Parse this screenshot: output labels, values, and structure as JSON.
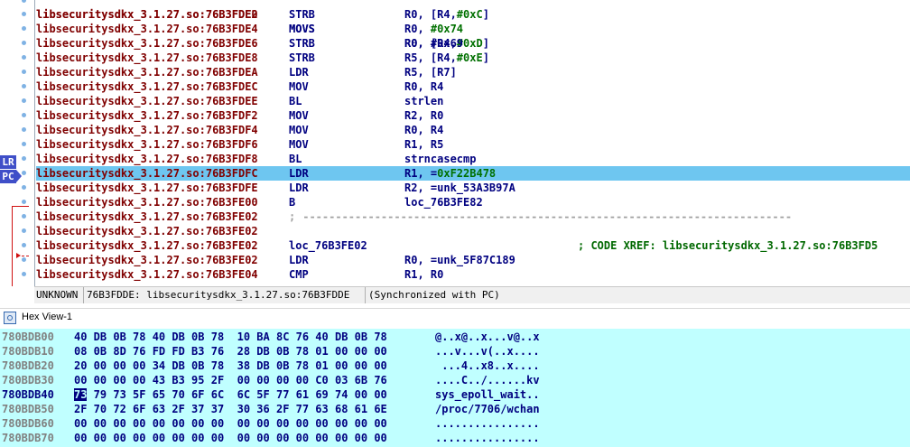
{
  "disasm": {
    "partial_top_row": {
      "addr": "libsecuritysdkx_3.1.27.so:76B3FDE0",
      "mnemonic": "MOVS",
      "operands": "R0, #0x69"
    },
    "rows": [
      {
        "addr": "libsecuritysdkx_3.1.27.so:76B3FDE2",
        "mnemonic": "STRB",
        "operands": "R0, [R4,#0xC]"
      },
      {
        "addr": "libsecuritysdkx_3.1.27.so:76B3FDE4",
        "mnemonic": "MOVS",
        "operands": "R0, #0x74"
      },
      {
        "addr": "libsecuritysdkx_3.1.27.so:76B3FDE6",
        "mnemonic": "STRB",
        "operands": "R0, [R4,#0xD]"
      },
      {
        "addr": "libsecuritysdkx_3.1.27.so:76B3FDE8",
        "mnemonic": "STRB",
        "operands": "R5, [R4,#0xE]"
      },
      {
        "addr": "libsecuritysdkx_3.1.27.so:76B3FDEA",
        "mnemonic": "LDR",
        "operands": "R5, [R7]"
      },
      {
        "addr": "libsecuritysdkx_3.1.27.so:76B3FDEC",
        "mnemonic": "MOV",
        "operands": "R0, R4"
      },
      {
        "addr": "libsecuritysdkx_3.1.27.so:76B3FDEE",
        "mnemonic": "BL",
        "operands": "strlen"
      },
      {
        "addr": "libsecuritysdkx_3.1.27.so:76B3FDF2",
        "mnemonic": "MOV",
        "operands": "R2, R0"
      },
      {
        "addr": "libsecuritysdkx_3.1.27.so:76B3FDF4",
        "mnemonic": "MOV",
        "operands": "R0, R4"
      },
      {
        "addr": "libsecuritysdkx_3.1.27.so:76B3FDF6",
        "mnemonic": "MOV",
        "operands": "R1, R5"
      },
      {
        "addr": "libsecuritysdkx_3.1.27.so:76B3FDF8",
        "mnemonic": "BL",
        "operands": "strncasecmp"
      },
      {
        "addr": "libsecuritysdkx_3.1.27.so:76B3FDFC",
        "mnemonic": "LDR",
        "operands": "R1, =0xF22B478"
      },
      {
        "addr": "libsecuritysdkx_3.1.27.so:76B3FDFE",
        "mnemonic": "LDR",
        "operands": "R2, =unk_53A3B97A"
      },
      {
        "addr": "libsecuritysdkx_3.1.27.so:76B3FE00",
        "mnemonic": "B",
        "operands": "loc_76B3FE82"
      },
      {
        "addr": "libsecuritysdkx_3.1.27.so:76B3FE02",
        "mnemonic": ";",
        "operands": "---------------------------------------------------------------------------"
      },
      {
        "addr": "libsecuritysdkx_3.1.27.so:76B3FE02",
        "mnemonic": "",
        "operands": ""
      },
      {
        "addr": "libsecuritysdkx_3.1.27.so:76B3FE02",
        "mnemonic": "loc_76B3FE02",
        "operands": "",
        "comment": "; CODE XREF: libsecuritysdkx_3.1.27.so:76B3FD5"
      },
      {
        "addr": "libsecuritysdkx_3.1.27.so:76B3FE02",
        "mnemonic": "LDR",
        "operands": "R0, =unk_5F87C189"
      },
      {
        "addr": "libsecuritysdkx_3.1.27.so:76B3FE04",
        "mnemonic": "CMP",
        "operands": "R1, R0"
      }
    ],
    "markers": {
      "lr": "LR",
      "pc": "PC"
    }
  },
  "status_bar": {
    "segments": [
      "UNKNOWN",
      "76B3FDDE: libsecuritysdkx_3.1.27.so:76B3FDDE",
      "(Synchronized with PC)"
    ]
  },
  "hex_view": {
    "title": "Hex View-1",
    "rows": [
      {
        "addr": "780BDB00",
        "bytes": "40 DB 0B 78 40 DB 0B 78  10 BA 8C 76 40 DB 0B 78",
        "ascii": "@..x@..x...v@..x"
      },
      {
        "addr": "780BDB10",
        "bytes": "08 0B 8D 76 FD FD B3 76  28 DB 0B 78 01 00 00 00",
        "ascii": "...v...v(..x...."
      },
      {
        "addr": "780BDB20",
        "bytes": "20 00 00 00 34 DB 0B 78  38 DB 0B 78 01 00 00 00",
        "ascii": " ...4..x8..x...."
      },
      {
        "addr": "780BDB30",
        "bytes": "00 00 00 00 43 B3 95 2F  00 00 00 00 C0 03 6B 76",
        "ascii": "....C../......kv"
      },
      {
        "addr": "780BDB40",
        "cursor_byte": "73",
        "bytes": " 79 73 5F 65 70 6F 6C  6C 5F 77 61 69 74 00 00",
        "ascii": "sys_epoll_wait.."
      },
      {
        "addr": "780BDB50",
        "bytes": "2F 70 72 6F 63 2F 37 37  30 36 2F 77 63 68 61 6E",
        "ascii": "/proc/7706/wchan"
      },
      {
        "addr": "780BDB60",
        "bytes": "00 00 00 00 00 00 00 00  00 00 00 00 00 00 00 00",
        "ascii": "................"
      },
      {
        "addr": "780BDB70",
        "bytes": "00 00 00 00 00 00 00 00  00 00 00 00 00 00 00 00",
        "ascii": "................"
      }
    ]
  },
  "colors": {
    "highlight_row": "#6ec6f0",
    "hex_background": "#c0ffff",
    "address": "#800000",
    "mnemonic": "#000080",
    "number": "#007000",
    "comment": "#006800",
    "marker": "#3f4fc8",
    "jump_arrow": "#d01010"
  },
  "icons": {
    "hex_view_tab": "hex-view-icon",
    "pc_marker": "arrow-right-icon",
    "jump": "arrow-down-icon"
  }
}
